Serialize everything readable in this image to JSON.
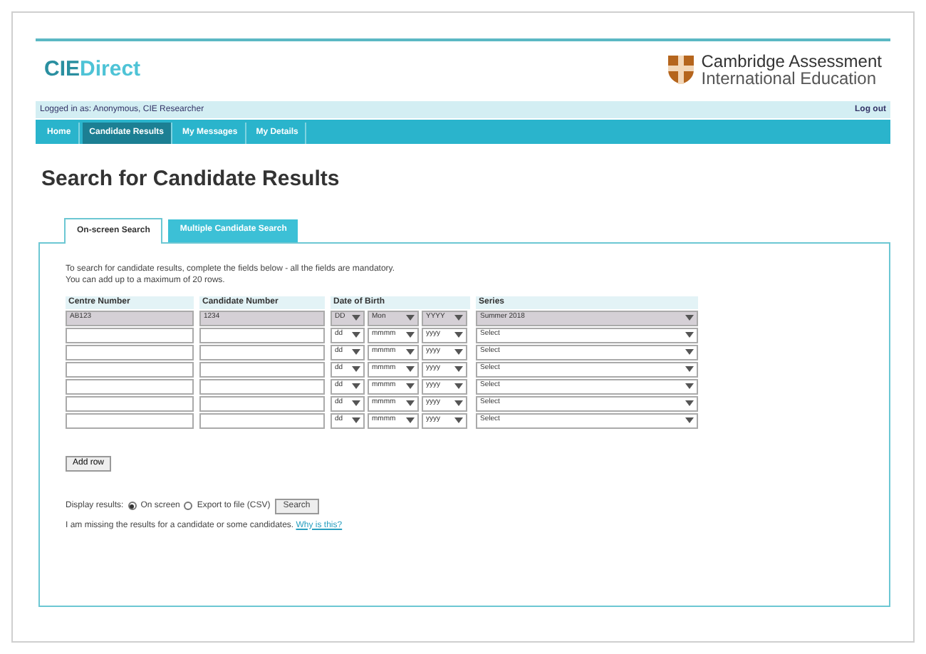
{
  "logo": {
    "part_1": "CIE",
    "part_2": "Direct"
  },
  "brand": {
    "line_1": "Cambridge Assessment",
    "line_2": "International Education"
  },
  "user_bar": {
    "text": "Logged in as: Anonymous, CIE Researcher",
    "logout": "Log out"
  },
  "nav": [
    {
      "label": "Home",
      "selected": false
    },
    {
      "label": "Candidate Results",
      "selected": true
    },
    {
      "label": "My Messages",
      "selected": false
    },
    {
      "label": "My Details",
      "selected": false
    }
  ],
  "heading": "Search for Candidate Results",
  "tabs": [
    {
      "label": "On-screen Search",
      "selected": true
    },
    {
      "label": "Multiple Candidate Search",
      "selected": false
    }
  ],
  "instructions": [
    "To search for candidate results, complete the fields below - all the fields are mandatory.",
    "You can add up to a maximum of 20 rows."
  ],
  "table": {
    "columns": [
      "Centre Number",
      "Candidate Number",
      "Date of Birth",
      "Series"
    ],
    "rows": [
      {
        "filled": true,
        "centre": "AB123",
        "candidate": "1234",
        "day": "DD",
        "month": "Mon",
        "year": "YYYY",
        "series": "Summer 2018"
      },
      {
        "filled": false,
        "day": "dd",
        "month": "mmmm",
        "year": "yyyy",
        "series": "Select"
      },
      {
        "filled": false,
        "day": "dd",
        "month": "mmmm",
        "year": "yyyy",
        "series": "Select"
      },
      {
        "filled": false,
        "day": "dd",
        "month": "mmmm",
        "year": "yyyy",
        "series": "Select"
      },
      {
        "filled": false,
        "day": "dd",
        "month": "mmmm",
        "year": "yyyy",
        "series": "Select"
      },
      {
        "filled": false,
        "day": "dd",
        "month": "mmmm",
        "year": "yyyy",
        "series": "Select"
      },
      {
        "filled": false,
        "day": "dd",
        "month": "mmmm",
        "year": "yyyy",
        "series": "Select"
      }
    ]
  },
  "add_row": "Add row",
  "display": {
    "label": "Display results:",
    "options": [
      {
        "label": "On screen",
        "selected": true
      },
      {
        "label": "Export to file (CSV)",
        "selected": false
      }
    ],
    "search": "Search"
  },
  "missing": {
    "text": "I am missing the results for a candidate or some candidates.",
    "link": "Why is this?"
  }
}
